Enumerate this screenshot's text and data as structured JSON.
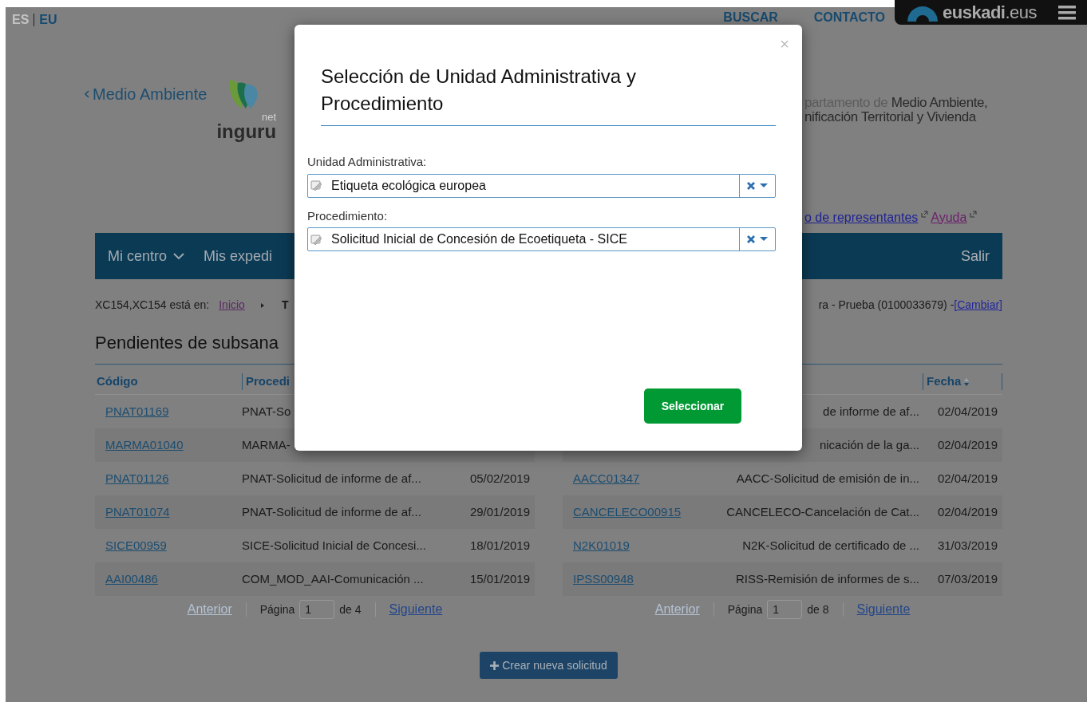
{
  "languages": [
    {
      "label": "ES",
      "selected": false
    },
    {
      "label": "EU",
      "selected": true
    }
  ],
  "top_links": [
    "BUSCAR",
    "CONTACTO"
  ],
  "portal_logo": {
    "text": "**euskadi**.eus"
  },
  "back_link": "Medio Ambiente",
  "site_logo": {
    "suffix": "net",
    "name": "inguru"
  },
  "department": {
    "prefix": "partamento de",
    "line_1": "Medio Ambiente,",
    "line_2": "nificación Territorial y Vivienda"
  },
  "user_links": [
    {
      "label": "o de representantes",
      "visited": false
    },
    {
      "label": "Ayuda",
      "visited": true
    }
  ],
  "nav": {
    "items": [
      {
        "label": "Mi centro",
        "dropdown": true
      },
      {
        "label": "Mis expedi",
        "dropdown": false
      }
    ],
    "logout": "Salir"
  },
  "breadcrumb": {
    "user": "XC154,XC154 está en:",
    "link": "Inicio",
    "current": "T",
    "context": "ra - Prueba (0100033679) - ",
    "change_link": "[Cambiar]"
  },
  "section_title": "Pendientes de subsana",
  "tables": [
    {
      "header": {
        "code": {
          "label": "Código"
        },
        "procedure": {
          "label": "Procedi"
        }
      },
      "rows": [
        {
          "code": "PNAT01169",
          "procedure": "PNAT-So"
        },
        {
          "code": "MARMA01040",
          "procedure": "MARMA-"
        },
        {
          "code": "PNAT01126",
          "procedure": "PNAT-Solicitud de informe de af...",
          "date": "05/02/2019"
        },
        {
          "code": "PNAT01074",
          "procedure": "PNAT-Solicitud de informe de af...",
          "date": "29/01/2019"
        },
        {
          "code": "SICE00959",
          "procedure": "SICE-Solicitud Inicial de Concesi...",
          "date": "18/01/2019"
        },
        {
          "code": "AAI00486",
          "procedure": "COM_MOD_AAI-Comunicación ...",
          "date": "15/01/2019"
        }
      ],
      "pager": {
        "previous": "Anterior",
        "previous_disabled": true,
        "page_label": "Página",
        "page": "1",
        "total": "de 4",
        "next": "Siguiente"
      }
    },
    {
      "header": {
        "date": {
          "label": "Fecha",
          "sortable": true
        }
      },
      "rows": [
        {
          "procedure": "de informe de af...",
          "date": "02/04/2019"
        },
        {
          "procedure": "nicación de la ga...",
          "date": "02/04/2019"
        },
        {
          "code": "AACC01347",
          "procedure": "AACC-Solicitud de emisión de in...",
          "date": "02/04/2019"
        },
        {
          "code": "CANCELECO00915",
          "procedure": "CANCELECO-Cancelación de Cat...",
          "date": "02/04/2019"
        },
        {
          "code": "N2K01019",
          "procedure": "N2K-Solicitud de certificado de ...",
          "date": "31/03/2019"
        },
        {
          "code": "IPSS00948",
          "procedure": "RISS-Remisión de informes de s...",
          "date": "07/03/2019"
        }
      ],
      "pager": {
        "previous": "Anterior",
        "previous_disabled": true,
        "page_label": "Página",
        "page": "1",
        "total": "de 8",
        "next": "Siguiente"
      }
    }
  ],
  "new_request_button": "Crear nueva solicitud",
  "modal": {
    "close": "×",
    "title": "Selección de Unidad Administrativa y Procedimiento",
    "fields": [
      {
        "label": "Unidad Administrativa:",
        "value": "Etiqueta ecológica europea",
        "clearable": true
      },
      {
        "label": "Procedimiento:",
        "value": "Solicitud Inicial de Concesión de Ecoetiqueta - SICE",
        "clearable": true
      }
    ],
    "submit": "Seleccionar"
  }
}
